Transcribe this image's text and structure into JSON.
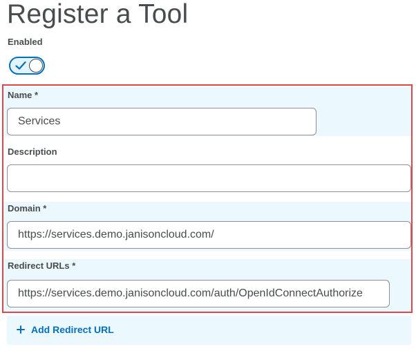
{
  "page": {
    "title": "Register a Tool"
  },
  "enabled": {
    "label": "Enabled",
    "value": true,
    "icon": "check-icon"
  },
  "form": {
    "name": {
      "label": "Name *",
      "value": "Services"
    },
    "description": {
      "label": "Description",
      "value": ""
    },
    "domain": {
      "label": "Domain *",
      "value": "https://services.demo.janisoncloud.com/"
    },
    "redirect_urls": {
      "label": "Redirect URLs *",
      "values": [
        "https://services.demo.janisoncloud.com/auth/OpenIdConnectAuthorize"
      ]
    }
  },
  "actions": {
    "add_redirect_url_label": "Add Redirect URL",
    "add_icon": "plus-icon"
  },
  "colors": {
    "accent": "#006fbf",
    "highlight_border": "#e04646",
    "field_background": "#ebf8fe",
    "text": "#494c4e"
  }
}
